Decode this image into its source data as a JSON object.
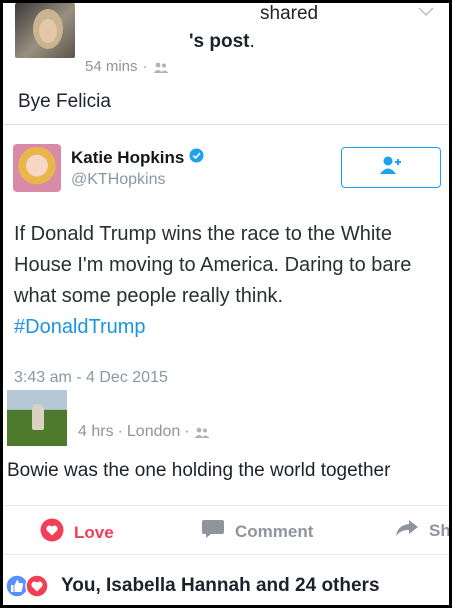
{
  "share_header": {
    "shared_label": "shared",
    "post_suffix": "'s post",
    "period": ".",
    "time": "54 mins",
    "separator": "·"
  },
  "status_text": "Bye Felicia",
  "tweet": {
    "name": "Katie Hopkins",
    "handle": "@KTHopkins",
    "body": "If Donald Trump wins the race to the White House I'm moving to America. Daring to bare what some people really think.",
    "hashtag": "#DonaldTrump",
    "timestamp": "3:43 am - 4 Dec 2015"
  },
  "comment": {
    "time": "4 hrs",
    "separator1": "·",
    "location": "London",
    "separator2": "·",
    "text": "Bowie was the one holding the world together"
  },
  "actions": {
    "love_label": "Love",
    "comment_label": "Comment",
    "share_label": "Sh"
  },
  "reactions_summary": "You, Isabella Hannah and 24 others",
  "colors": {
    "love": "#f33e58",
    "twitter_blue": "#1da1f2",
    "like_blue": "#5890ff",
    "meta_gray": "#90949c"
  }
}
